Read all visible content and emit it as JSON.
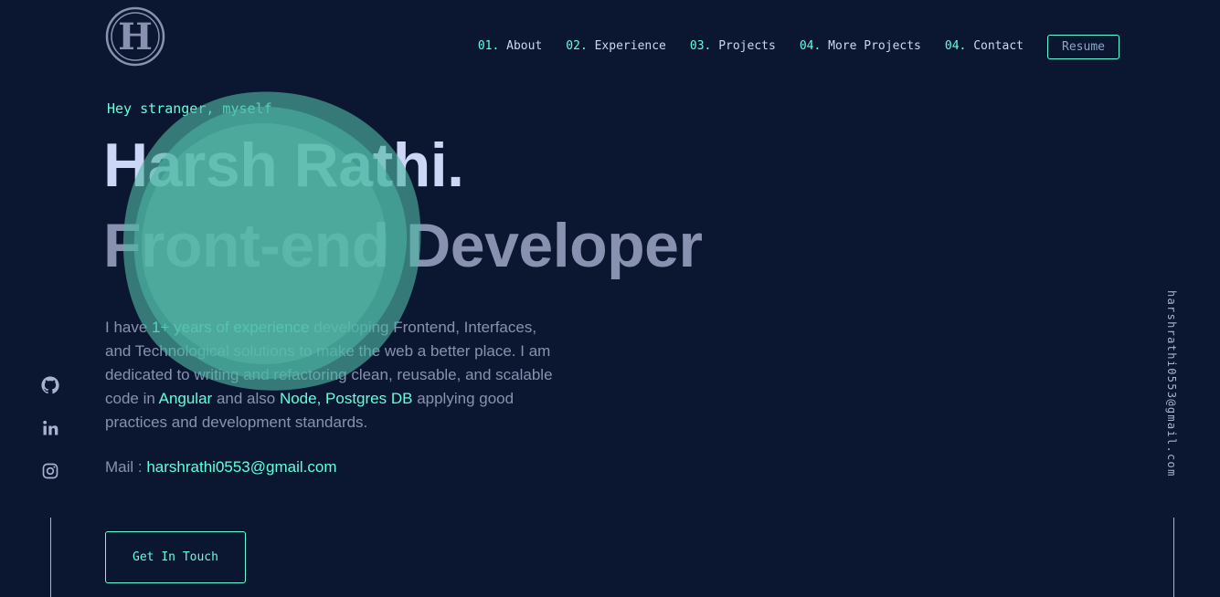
{
  "brand": {
    "logo_letter": "H"
  },
  "nav": {
    "items": [
      {
        "num": "01.",
        "label": "About"
      },
      {
        "num": "02.",
        "label": "Experience"
      },
      {
        "num": "03.",
        "label": "Projects"
      },
      {
        "num": "04.",
        "label": "More Projects"
      },
      {
        "num": "04.",
        "label": "Contact"
      }
    ],
    "resume_label": "Resume"
  },
  "hero": {
    "greeting": "Hey stranger, myself",
    "name": "Harsh Rathi.",
    "role": "Front-end Developer",
    "bio": {
      "p1": "I have ",
      "h1": "1+ years of experience",
      "p2": " developing Frontend, Interfaces, and Technological solutions to make the web a better place. I am dedicated to writing and refactoring clean, reusable, and scalable code in ",
      "h2": "Angular",
      "p3": " and also ",
      "h3": "Node, Postgres DB",
      "p4": " applying good practices and development standards."
    },
    "mail_label": "Mail : ",
    "mail_value": "harshrathi0553@gmail.com",
    "cta_label": "Get In Touch"
  },
  "social": {
    "icons": [
      "github-icon",
      "linkedin-icon",
      "instagram-icon"
    ]
  },
  "side_email": "harshrathi0553@gmail.com",
  "colors": {
    "background": "#0b1730",
    "accent": "#64ffda",
    "heading": "#ccd6f6",
    "body_text": "#8892b0",
    "blob": "#4fb8a6"
  }
}
